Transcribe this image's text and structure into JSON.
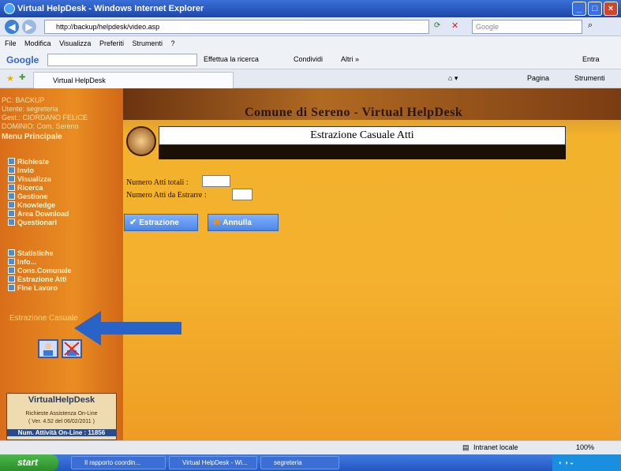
{
  "window": {
    "title": "Virtual HelpDesk - Windows Internet Explorer",
    "address": "http://backup/helpdesk/video.asp",
    "search_placeholder": "Google"
  },
  "menubar": [
    "File",
    "Modifica",
    "Visualizza",
    "Preferiti",
    "Strumenti",
    "?"
  ],
  "google_toolbar": {
    "logo": "Google",
    "search_btn": "Effettua la ricerca",
    "share": "Condividi",
    "more": "Altri »",
    "signin": "Entra"
  },
  "tabbar": {
    "tab_label": "Virtual HelpDesk",
    "page_menu": "Pagina",
    "tools_menu": "Strumenti"
  },
  "sidebar": {
    "header_lines": [
      "PC: BACKUP",
      "Utente: segreteria",
      "Gest.: CIORDANO FELICE",
      "DOMINIO: Com. Sereno"
    ],
    "menu_title": "Menu Principale",
    "items_a": [
      "Richieste",
      "Invio",
      "Visualizza",
      "Ricerca",
      "Gestione",
      "Knowledge",
      "Area Download",
      "Questionari"
    ],
    "items_b": [
      "Statistiche",
      "Info...",
      "Cons.Comunale",
      "Estrazione Atti",
      "Fine Lavoro"
    ],
    "estrazione_label": "Estrazione Casuale",
    "brand": {
      "name": "VirtualHelpDesk",
      "tagline": "Richieste Assistenza On-Line",
      "version": "( Ver. 4.52 del 06/02/2011 )",
      "online": "Num. Attività On-Line : 11856"
    }
  },
  "main": {
    "banner_title": "Comune di Sereno - Virtual HelpDesk",
    "header_title": "Estrazione Casuale Atti",
    "field_total": "Numero Atti totali :",
    "field_extract": "Numero Atti da Estrarre :",
    "total_value": "",
    "extract_value": "",
    "btn_estrazione": "Estrazione",
    "btn_annulla": "Annulla"
  },
  "statusbar": {
    "zone": "Intranet locale",
    "zoom": "100%"
  },
  "taskbar": {
    "start": "start",
    "tasks": [
      "Il rapporto coordin...",
      "Virtual HelpDesk - Wi...",
      "segreteria"
    ]
  },
  "colors": {
    "accent": "#f2b22c",
    "sidebar": "#e98d22",
    "arrow": "#2a63c8"
  }
}
